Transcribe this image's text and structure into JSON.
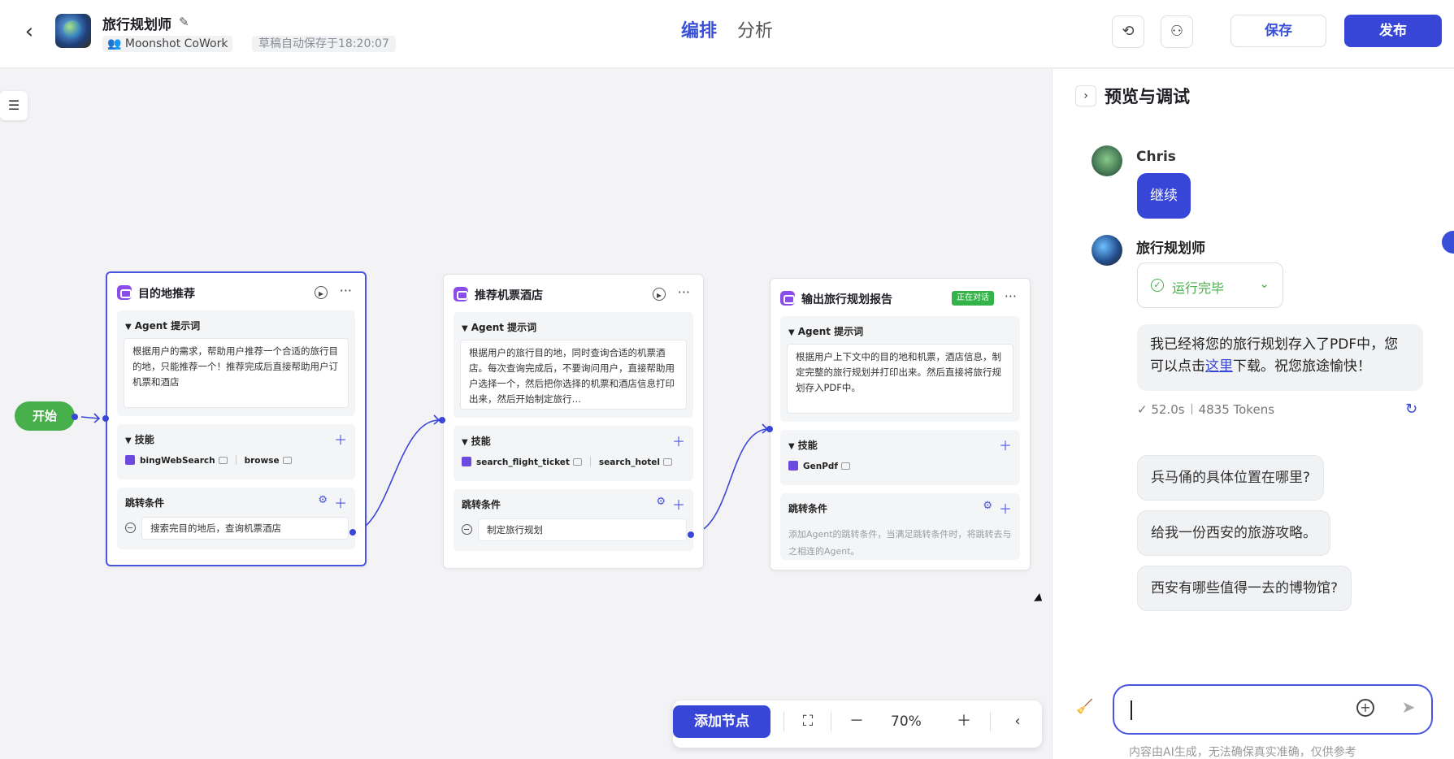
{
  "header": {
    "back_icon": "chevron-left-icon",
    "app_name": "旅行规划师",
    "workspace": "Moonshot CoWork",
    "autosave": "草稿自动保存于18:20:07",
    "tabs": [
      {
        "label": "编排",
        "active": true
      },
      {
        "label": "分析",
        "active": false
      }
    ],
    "history_icon": "history-icon",
    "collab_icon": "user-add-icon",
    "save_label": "保存",
    "publish_label": "发布",
    "accent": "#3846d8"
  },
  "canvas": {
    "start_label": "开始",
    "nodes": [
      {
        "title": "目的地推荐",
        "prompt_label": "Agent 提示词",
        "prompt": "根据用户的需求，帮助用户推荐一个合适的旅行目的地，只能推荐一个！推荐完成后直接帮助用户订机票和酒店",
        "skills_label": "技能",
        "skills": [
          "bingWebSearch",
          "browse"
        ],
        "cond_label": "跳转条件",
        "condition": "搜索完目的地后，查询机票酒店"
      },
      {
        "title": "推荐机票酒店",
        "prompt_label": "Agent 提示词",
        "prompt": "根据用户的旅行目的地，同时查询合适的机票酒店。每次查询完成后，不要询问用户，直接帮助用户选择一个，然后把你选择的机票和酒店信息打印出来，然后开始制定旅行…",
        "skills_label": "技能",
        "skills": [
          "search_flight_ticket",
          "search_hotel"
        ],
        "cond_label": "跳转条件",
        "condition": "制定旅行规划"
      },
      {
        "title": "输出旅行规划报告",
        "badge": "正在对话",
        "prompt_label": "Agent 提示词",
        "prompt": "根据用户上下文中的目的地和机票，酒店信息，制定完整的旅行规划并打印出来。然后直接将旅行规划存入PDF中。",
        "skills_label": "技能",
        "skills": [
          "GenPdf"
        ],
        "cond_label": "跳转条件",
        "cond_hint": "添加Agent的跳转条件，当满足跳转条件时，将跳转去与之相连的Agent。"
      }
    ],
    "toolbar": {
      "add_node_label": "添加节点",
      "fit_icon": "fit-view-icon",
      "zoom_out_icon": "minus-icon",
      "zoom": "70%",
      "zoom_in_icon": "plus-icon",
      "collapse_icon": "collapse-icon"
    }
  },
  "panel": {
    "title": "预览与调试",
    "user_name": "Chris",
    "user_message": "继续",
    "bot_name": "旅行规划师",
    "run_status": "运行完毕",
    "bot_message_before": "我已经将您的旅行规划存入了PDF中，您可以点击",
    "bot_message_link": "这里",
    "bot_message_after": "下载。祝您旅途愉快！",
    "duration": "52.0s",
    "tokens": "4835 Tokens",
    "suggestions": [
      "兵马俑的具体位置在哪里?",
      "给我一份西安的旅游攻略。",
      "西安有哪些值得一去的博物馆?"
    ],
    "input_value": "",
    "disclaimer": "内容由AI生成，无法确保真实准确，仅供参考"
  }
}
